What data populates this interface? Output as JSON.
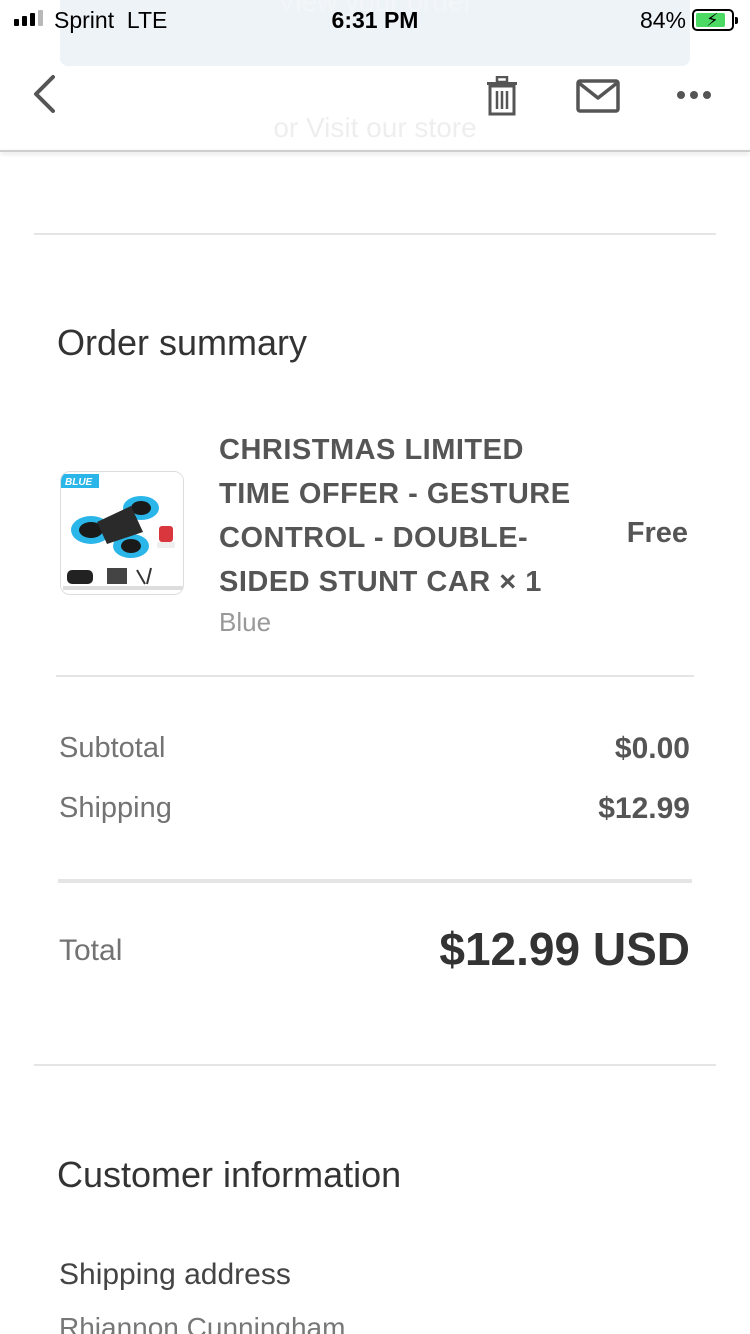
{
  "background_email": {
    "button_text": "View your order",
    "link_text": "or Visit our store"
  },
  "status_bar": {
    "carrier": "Sprint",
    "network": "LTE",
    "time": "6:31 PM",
    "battery_percent": "84%",
    "battery_level": 0.84,
    "signal_bars_active": 3,
    "signal_bars_total": 4
  },
  "toolbar": {
    "back_icon": "chevron-left-icon",
    "trash_icon": "trash-icon",
    "mail_icon": "mail-icon",
    "more_icon": "more-horizontal-icon"
  },
  "order_summary": {
    "title": "Order summary",
    "item": {
      "title": "CHRISTMAS LIMITED TIME OFFER - GESTURE CONTROL - DOUBLE-SIDED STUNT CAR × 1",
      "variant": "Blue",
      "price": "Free",
      "image_badge": "BLUE"
    },
    "subtotal_label": "Subtotal",
    "subtotal_value": "$0.00",
    "shipping_label": "Shipping",
    "shipping_value": "$12.99",
    "total_label": "Total",
    "total_value": "$12.99 USD"
  },
  "customer_information": {
    "title": "Customer information",
    "shipping_address_label": "Shipping address",
    "shipping_address_name": "Rhiannon Cunningham"
  },
  "colors": {
    "accent_blue": "#2ab6e8",
    "divider": "#e5e5e5",
    "text_dark": "#333333",
    "text_muted": "#737373"
  }
}
